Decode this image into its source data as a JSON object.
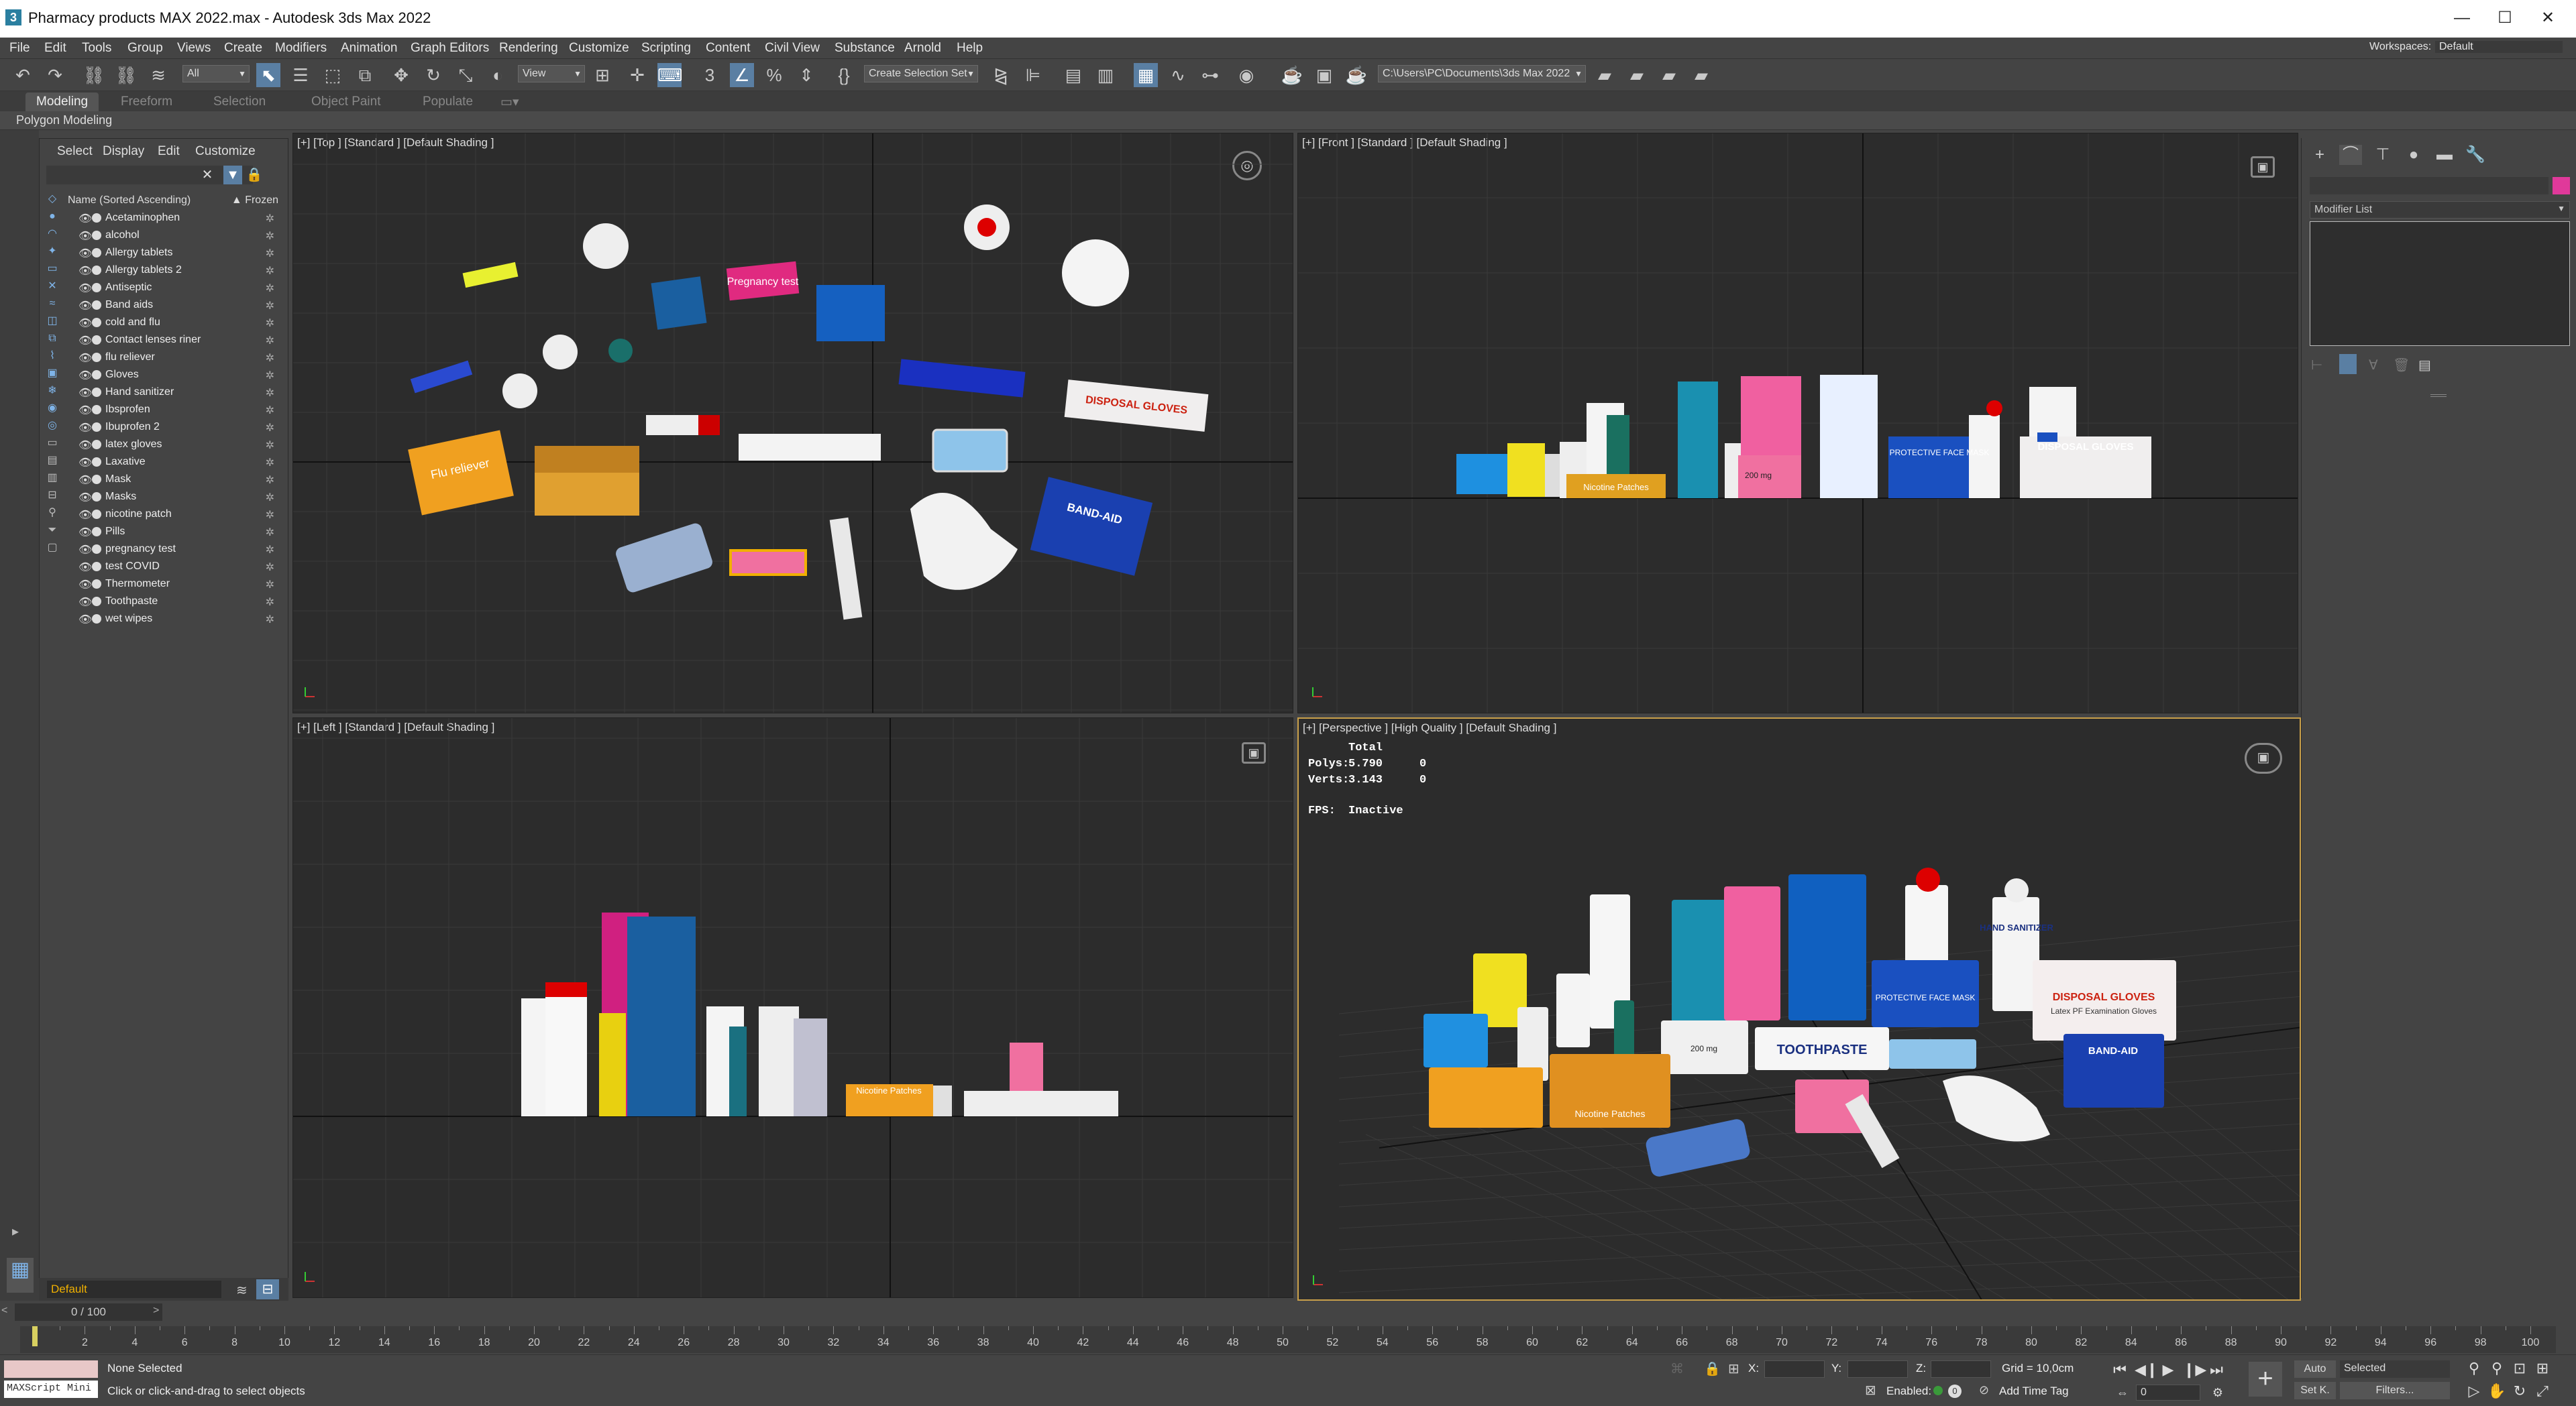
{
  "window": {
    "title": "Pharmacy products MAX 2022.max - Autodesk 3ds Max 2022",
    "app_icon": "3",
    "min": "—",
    "max": "☐",
    "close": "✕"
  },
  "menu": [
    "File",
    "Edit",
    "Tools",
    "Group",
    "Views",
    "Create",
    "Modifiers",
    "Animation",
    "Graph Editors",
    "Rendering",
    "Customize",
    "Scripting",
    "Content",
    "Civil View",
    "Substance",
    "Arnold",
    "Help"
  ],
  "workspaces": {
    "label": "Workspaces:",
    "value": "Default"
  },
  "toolbar": {
    "filter": "All",
    "view": "View",
    "selection_set": "Create Selection Set",
    "path": "C:\\Users\\PC\\Documents\\3ds Max 2022"
  },
  "ribbon": {
    "tabs": [
      "Modeling",
      "Freeform",
      "Selection",
      "Object Paint",
      "Populate"
    ],
    "active": "Modeling",
    "sub": "Polygon Modeling"
  },
  "scene_explorer": {
    "tabs": [
      "Select",
      "Display",
      "Edit",
      "Customize"
    ],
    "col_name": "Name (Sorted Ascending)",
    "col_frozen": "▲ Frozen",
    "items": [
      "Acetaminophen",
      "alcohol",
      "Allergy tablets",
      "Allergy tablets 2",
      "Antiseptic",
      "Band aids",
      "cold and flu",
      "Contact lenses riner",
      "flu reliever",
      "Gloves",
      "Hand sanitizer",
      "Ibsprofen",
      "Ibuprofen 2",
      "latex gloves",
      "Laxative",
      "Mask",
      "Masks",
      "nicotine patch",
      "Pills",
      "pregnancy test",
      "test COVID",
      "Thermometer",
      "Toothpaste",
      "wet wipes"
    ],
    "layer": "Default"
  },
  "viewports": {
    "top": "[+] [Top ] [Standard ] [Default Shading ]",
    "front": "[+] [Front ] [Standard ] [Default Shading ]",
    "left": "[+] [Left ] [Standard ] [Default Shading ]",
    "perspective": "[+] [Perspective ] [High Quality ] [Default Shading ]"
  },
  "stats": {
    "total": "Total",
    "polys_label": "Polys:",
    "polys": "5.790",
    "polys_sel": "0",
    "verts_label": "Verts:",
    "verts": "3.143",
    "verts_sel": "0",
    "fps_label": "FPS:",
    "fps": "Inactive"
  },
  "command_panel": {
    "modifier_list": "Modifier List"
  },
  "timeline": {
    "frame": "0 / 100",
    "ticks": [
      "0",
      "2",
      "4",
      "6",
      "8",
      "10",
      "12",
      "14",
      "16",
      "18",
      "20",
      "22",
      "24",
      "26",
      "28",
      "30",
      "32",
      "34",
      "36",
      "38",
      "40",
      "42",
      "44",
      "46",
      "48",
      "50",
      "52",
      "54",
      "56",
      "58",
      "60",
      "62",
      "64",
      "66",
      "68",
      "70",
      "72",
      "74",
      "76",
      "78",
      "80",
      "82",
      "84",
      "86",
      "88",
      "90",
      "92",
      "94",
      "96",
      "98",
      "100"
    ]
  },
  "status": {
    "maxscript": "MAXScript Mini",
    "selected": "None Selected",
    "prompt": "Click or click-and-drag to select objects",
    "x": "X:",
    "y": "Y:",
    "z": "Z:",
    "grid": "Grid = 10,0cm",
    "enabled": "Enabled:",
    "addtimetag": "Add Time Tag",
    "auto": "Auto",
    "setk": "Set K.",
    "selected_dd": "Selected",
    "filters": "Filters...",
    "frame_field": "0"
  },
  "product_labels": {
    "pregnancy": "Pregnancy test",
    "bandaid": "BAND-AID",
    "gloves": "DISPOSAL GLOVES",
    "flu": "Flu reliever",
    "nicotine": "Nicotine Patches",
    "toothpaste": "TOOTHPASTE",
    "hand": "HAND SANITIZER",
    "mask": "PROTECTIVE FACE MASK",
    "latex": "Latex PF Examination Gloves",
    "dose": "200 mg",
    "nicotine2": "Nicotine Transdermal System Patch"
  }
}
